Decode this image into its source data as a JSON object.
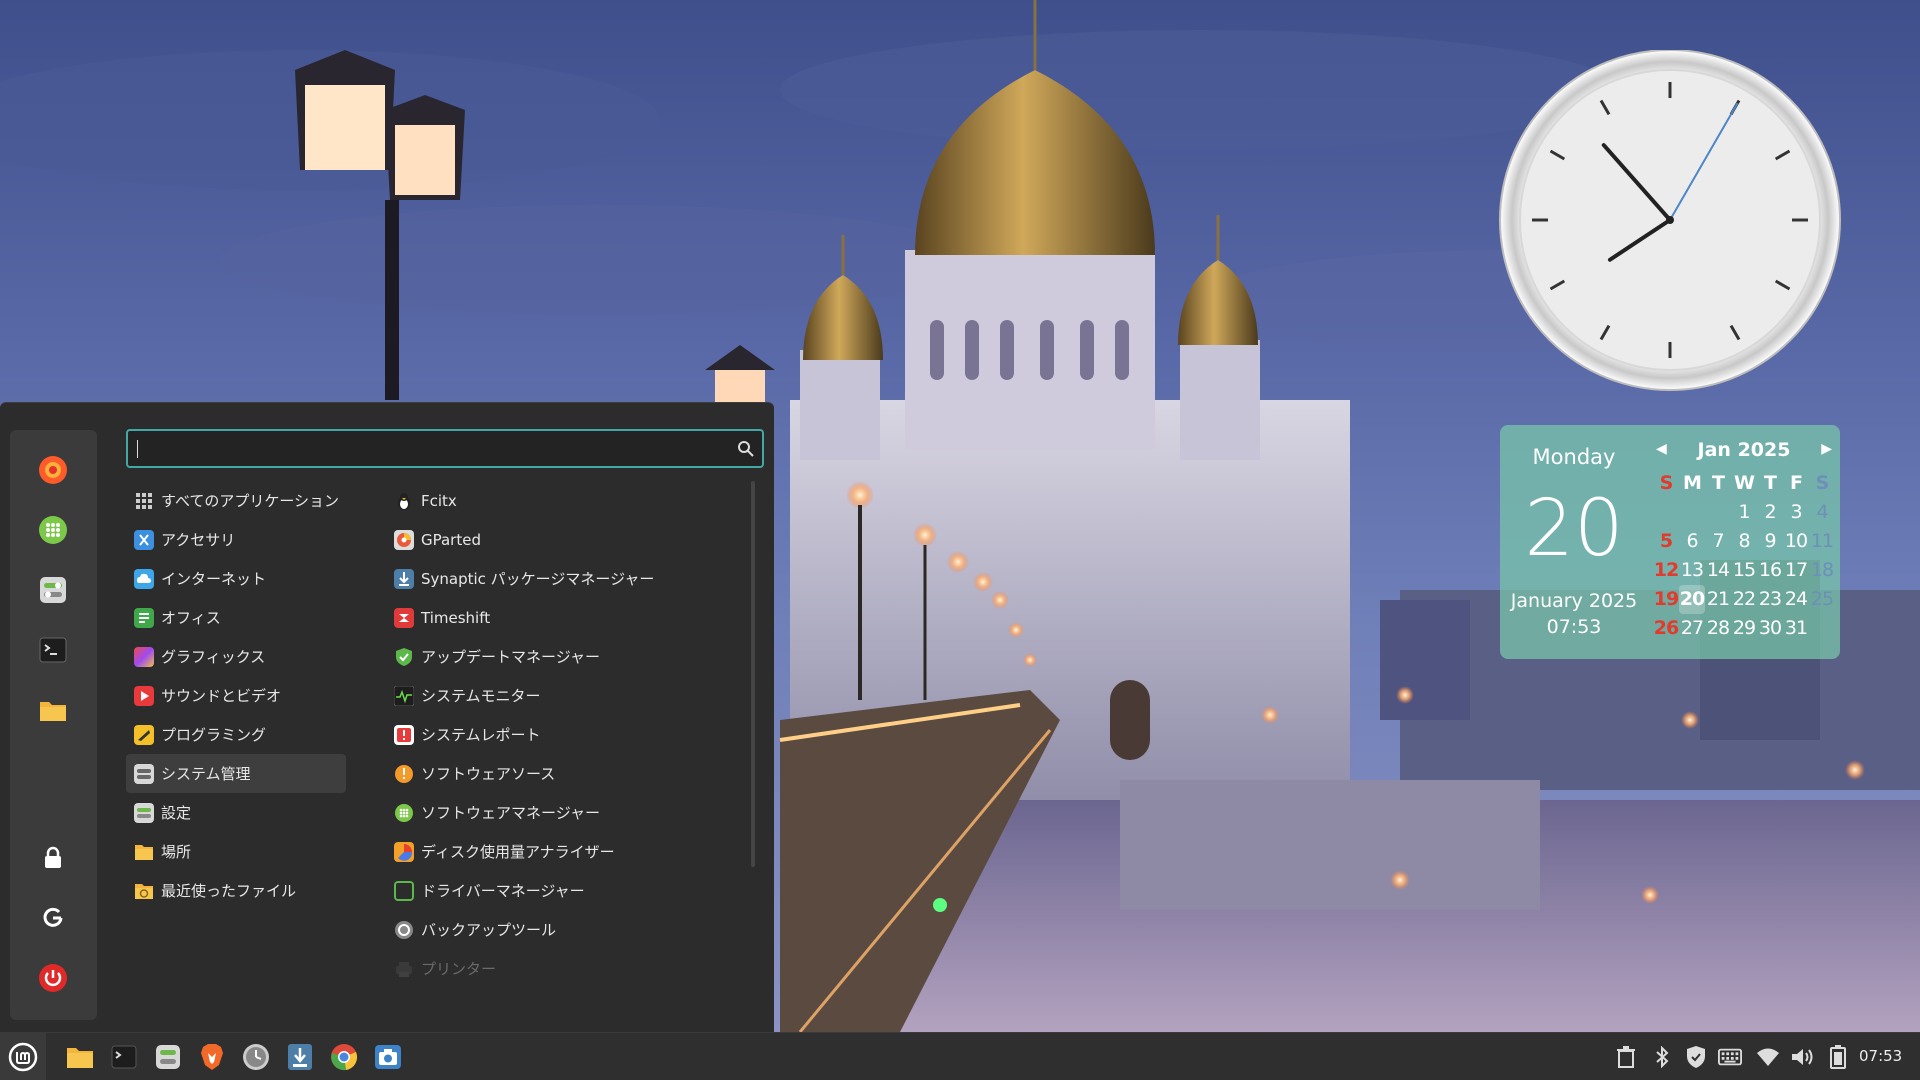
{
  "calendar": {
    "weekday": "Monday",
    "day": "20",
    "month_year": "January 2025",
    "time": "07:53",
    "title": "Jan 2025",
    "prev_icon": "triangle-left-icon",
    "next_icon": "triangle-right-icon",
    "weekday_headers": [
      "S",
      "M",
      "T",
      "W",
      "T",
      "F",
      "S"
    ],
    "weeks": [
      [
        "",
        "",
        "",
        "1",
        "2",
        "3",
        "4"
      ],
      [
        "5",
        "6",
        "7",
        "8",
        "9",
        "10",
        "11"
      ],
      [
        "12",
        "13",
        "14",
        "15",
        "16",
        "17",
        "18"
      ],
      [
        "19",
        "20",
        "21",
        "22",
        "23",
        "24",
        "25"
      ],
      [
        "26",
        "27",
        "28",
        "29",
        "30",
        "31",
        ""
      ]
    ],
    "today": "20",
    "colors": {
      "background": "#78c8aa",
      "sunday": "#e23b2e",
      "saturday": "#6d8fb8"
    }
  },
  "clock": {
    "hour": 7,
    "minute": 53,
    "second": 5
  },
  "menu": {
    "search": {
      "value": "",
      "placeholder": ""
    },
    "favorites": [
      {
        "name": "firefox-icon"
      },
      {
        "name": "software-manager-icon"
      },
      {
        "name": "system-settings-icon"
      },
      {
        "name": "terminal-icon"
      },
      {
        "name": "folder-icon"
      },
      {
        "name": "lock-screen-icon"
      },
      {
        "name": "logout-icon"
      },
      {
        "name": "power-icon"
      }
    ],
    "categories": [
      {
        "label": "すべてのアプリケーション",
        "icon": "grid-icon"
      },
      {
        "label": "アクセサリ",
        "icon": "accessories-icon"
      },
      {
        "label": "インターネット",
        "icon": "internet-icon"
      },
      {
        "label": "オフィス",
        "icon": "office-icon"
      },
      {
        "label": "グラフィックス",
        "icon": "graphics-icon"
      },
      {
        "label": "サウンドとビデオ",
        "icon": "sound-video-icon"
      },
      {
        "label": "プログラミング",
        "icon": "programming-icon"
      },
      {
        "label": "システム管理",
        "icon": "system-admin-icon"
      },
      {
        "label": "設定",
        "icon": "settings-icon"
      },
      {
        "label": "場所",
        "icon": "places-icon"
      },
      {
        "label": "最近使ったファイル",
        "icon": "recent-files-icon"
      }
    ],
    "selected_category": "システム管理",
    "apps": [
      {
        "label": "Fcitx",
        "icon": "fcitx-icon"
      },
      {
        "label": "GParted",
        "icon": "gparted-icon"
      },
      {
        "label": "Synaptic パッケージマネージャー",
        "icon": "synaptic-icon"
      },
      {
        "label": "Timeshift",
        "icon": "timeshift-icon"
      },
      {
        "label": "アップデートマネージャー",
        "icon": "update-manager-icon"
      },
      {
        "label": "システムモニター",
        "icon": "system-monitor-icon"
      },
      {
        "label": "システムレポート",
        "icon": "system-report-icon"
      },
      {
        "label": "ソフトウェアソース",
        "icon": "software-sources-icon"
      },
      {
        "label": "ソフトウェアマネージャー",
        "icon": "software-manager-icon"
      },
      {
        "label": "ディスク使用量アナライザー",
        "icon": "disk-usage-icon"
      },
      {
        "label": "ドライバーマネージャー",
        "icon": "driver-manager-icon"
      },
      {
        "label": "バックアップツール",
        "icon": "backup-tool-icon"
      },
      {
        "label": "プリンター",
        "icon": "printer-icon"
      }
    ]
  },
  "panel": {
    "menu_icon": "linux-mint-logo-icon",
    "launchers": [
      {
        "name": "files-launcher",
        "icon": "folder-icon"
      },
      {
        "name": "terminal-launcher",
        "icon": "terminal-icon"
      },
      {
        "name": "settings-launcher",
        "icon": "system-settings-icon"
      },
      {
        "name": "brave-launcher",
        "icon": "brave-browser-icon"
      },
      {
        "name": "clock-app-launcher",
        "icon": "clock-app-icon"
      },
      {
        "name": "synaptic-launcher",
        "icon": "package-manager-icon"
      },
      {
        "name": "chromium-launcher",
        "icon": "chromium-icon"
      },
      {
        "name": "screenshot-launcher",
        "icon": "camera-icon"
      }
    ],
    "tray": [
      {
        "name": "trash-icon"
      },
      {
        "name": "bluetooth-icon"
      },
      {
        "name": "shield-icon"
      },
      {
        "name": "keyboard-icon"
      },
      {
        "name": "wifi-icon"
      },
      {
        "name": "volume-icon"
      },
      {
        "name": "battery-icon"
      }
    ],
    "time": "07:53"
  }
}
